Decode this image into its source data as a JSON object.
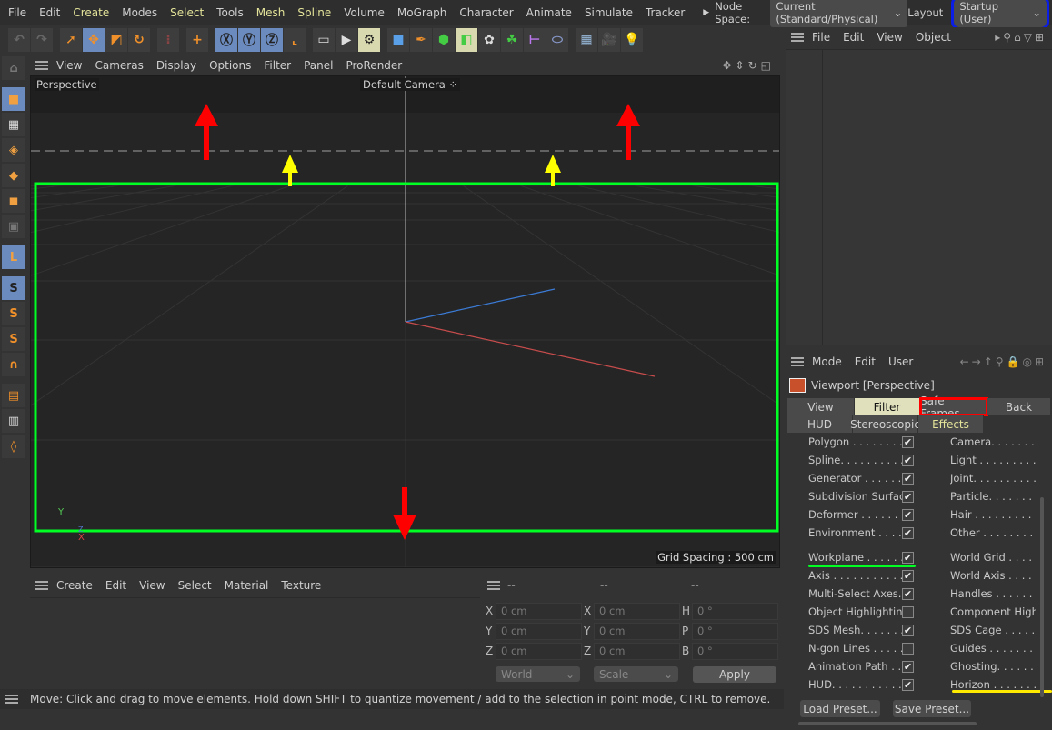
{
  "menu": {
    "items": [
      "File",
      "Edit",
      "Create",
      "Modes",
      "Select",
      "Tools",
      "Mesh",
      "Spline",
      "Volume",
      "MoGraph",
      "Character",
      "Animate",
      "Simulate",
      "Tracker"
    ],
    "highlighted": [
      "Create",
      "Select",
      "Mesh",
      "Spline"
    ],
    "node_space_label": "Node Space:",
    "node_space_value": "Current (Standard/Physical)",
    "layout_label": "Layout",
    "layout_value": "Startup (User)"
  },
  "toolbar": {
    "icons": [
      "undo-icon",
      "redo-icon",
      "live-selection-icon",
      "move-icon",
      "scale-icon",
      "rotate-icon",
      "psr-icon",
      "add-icon",
      "x-axis-icon",
      "y-axis-icon",
      "z-axis-icon",
      "coordinate-system-icon",
      "render-view-icon",
      "render-picture-viewer-icon",
      "render-settings-icon",
      "cube-icon",
      "pen-icon",
      "subdivision-icon",
      "extrude-icon",
      "mograph-icon",
      "cloner-icon",
      "symmetry-icon",
      "deformer-icon",
      "floor-icon",
      "camera-icon",
      "light-icon"
    ],
    "axis_labels": [
      "X",
      "Y",
      "Z"
    ]
  },
  "left_toolbar": {
    "icons": [
      "make-editable-icon",
      "model-mode-icon",
      "texture-mode-icon",
      "points-mode-icon",
      "edges-mode-icon",
      "polygons-mode-icon",
      "uv-mode-icon",
      "axis-mode-icon",
      "snap-icon",
      "snap-settings-icon",
      "snap-enable-icon",
      "magnet-icon",
      "workplane-icon",
      "lock-workplane-icon",
      "workplane-mode-icon"
    ]
  },
  "viewport": {
    "menu": [
      "View",
      "Cameras",
      "Display",
      "Options",
      "Filter",
      "Panel",
      "ProRender"
    ],
    "view_name": "Perspective",
    "camera": "Default Camera",
    "grid_spacing": "Grid Spacing : 500 cm",
    "axis_y": "Y",
    "axis_x": "X",
    "axis_z": "Z",
    "annotation_colors": {
      "safe_frame": "#00ff22",
      "arrows_red": "#ff0000",
      "arrows_yellow": "#ffff00"
    }
  },
  "object_manager": {
    "menu": [
      "File",
      "Edit",
      "View",
      "Object"
    ]
  },
  "attribute_manager": {
    "menu": [
      "Mode",
      "Edit",
      "User"
    ],
    "title": "Viewport [Perspective]",
    "tabs_row1": [
      "View",
      "Filter",
      "Safe Frames",
      "Back"
    ],
    "tabs_row2": [
      "HUD",
      "Stereoscopic",
      "Effects"
    ],
    "active_tab": "Filter",
    "left_filters": [
      {
        "label": "Polygon . . . . . . . . .",
        "checked": true
      },
      {
        "label": "Spline. . . . . . . . . .",
        "checked": true
      },
      {
        "label": "Generator . . . . . . .",
        "checked": true
      },
      {
        "label": "Subdivision Surface",
        "checked": true
      },
      {
        "label": "Deformer . . . . . . . .",
        "checked": true
      },
      {
        "label": "Environment . . . . .",
        "checked": true
      },
      {
        "label": "Workplane . . . . . .",
        "checked": true
      },
      {
        "label": "Axis . . . . . . . . . . .",
        "checked": true
      },
      {
        "label": "Multi-Select Axes. .",
        "checked": true
      },
      {
        "label": "Object Highlighting",
        "checked": false
      },
      {
        "label": "SDS Mesh. . . . . . .",
        "checked": true
      },
      {
        "label": "N-gon Lines . . . . .",
        "checked": false
      },
      {
        "label": "Animation Path . . .",
        "checked": true
      },
      {
        "label": "HUD. . . . . . . . . . .",
        "checked": true
      }
    ],
    "right_filters": [
      "Camera. . . . . . . . .",
      "Light . . . . . . . . . .",
      "Joint. . . . . . . . . . .",
      "Particle. . . . . . . . .",
      "Hair . . . . . . . . . . .",
      "Other . . . . . . . . . .",
      "World Grid . . . . . .",
      "World Axis . . . . . .",
      "Handles . . . . . . . .",
      "Component Highli",
      "SDS Cage . . . . . . .",
      "Guides . . . . . . . . .",
      "Ghosting. . . . . . . .",
      "Horizon . . . . . . . ."
    ],
    "load_preset": "Load Preset...",
    "save_preset": "Save Preset..."
  },
  "material_manager": {
    "menu": [
      "Create",
      "Edit",
      "View",
      "Select",
      "Material",
      "Texture"
    ]
  },
  "coordinates": {
    "headers": [
      "--",
      "--",
      "--"
    ],
    "rows": [
      [
        "X",
        "0 cm",
        "X",
        "0 cm",
        "H",
        "0 °"
      ],
      [
        "Y",
        "0 cm",
        "Y",
        "0 cm",
        "P",
        "0 °"
      ],
      [
        "Z",
        "0 cm",
        "Z",
        "0 cm",
        "B",
        "0 °"
      ]
    ],
    "mode": "World",
    "size_mode": "Scale",
    "apply": "Apply"
  },
  "status": "Move: Click and drag to move elements. Hold down SHIFT to quantize movement / add to the selection in point mode, CTRL to remove."
}
